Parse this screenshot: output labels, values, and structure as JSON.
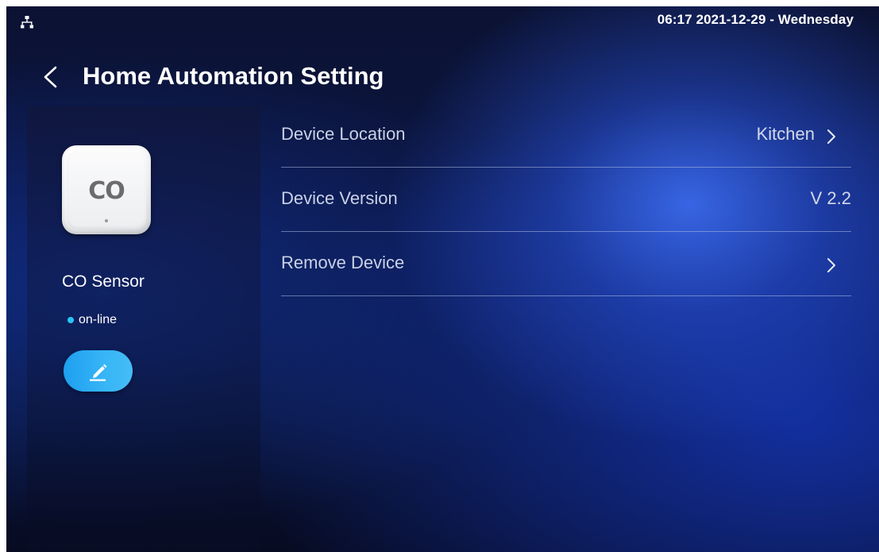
{
  "status_bar": {
    "network_icon": "network-tree-icon",
    "datetime": "06:17  2021-12-29 - Wednesday"
  },
  "header": {
    "back_icon": "chevron-left-icon",
    "title": "Home Automation Setting"
  },
  "device": {
    "tile_text": "CO",
    "name": "CO Sensor",
    "status": "on-line",
    "status_color": "#29c4f5",
    "edit_icon": "pencil-icon",
    "edit_button_color": "#2aa8f2"
  },
  "settings": {
    "rows": [
      {
        "label": "Device Location",
        "value": "Kitchen",
        "chevron_icon": "chevron-right-icon"
      },
      {
        "label": "Device Version",
        "value": "V 2.2"
      },
      {
        "label": "Remove Device",
        "value": "",
        "chevron_icon": "chevron-right-icon"
      }
    ]
  }
}
